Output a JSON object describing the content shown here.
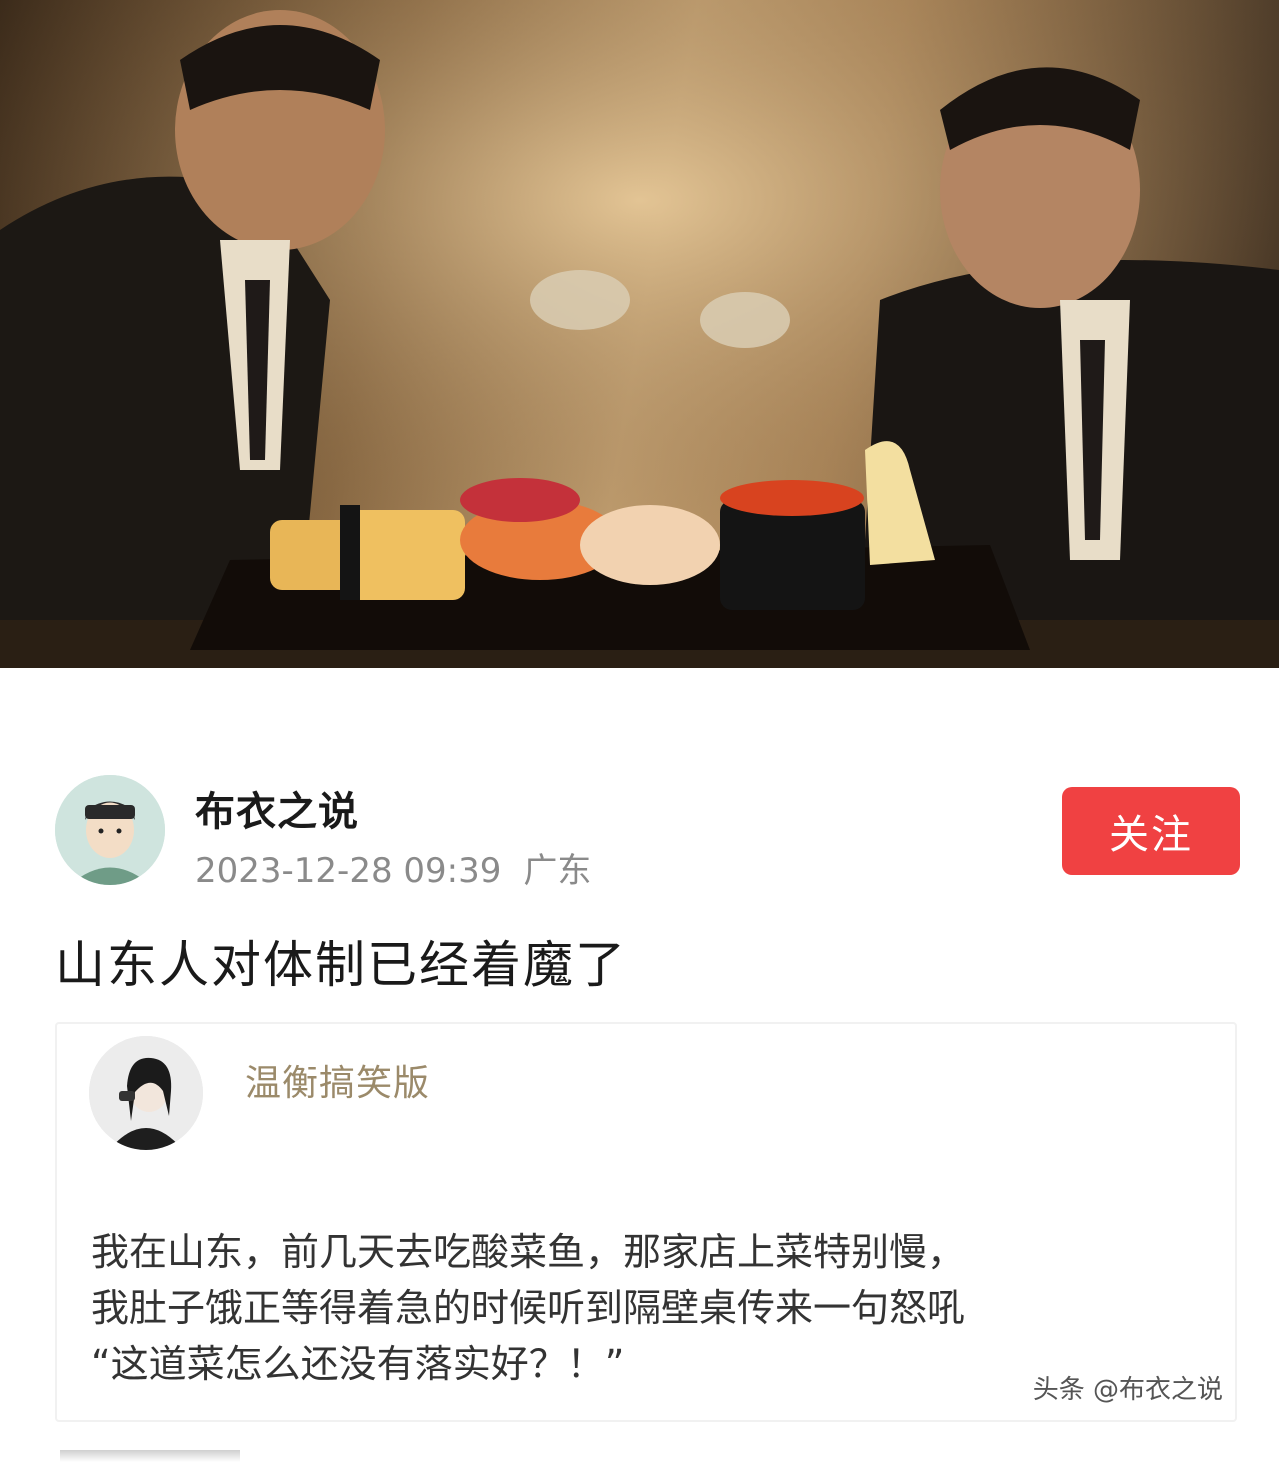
{
  "author": {
    "name": "布衣之说",
    "date": "2023-12-28 09:39",
    "location": "广东",
    "follow_label": "关注"
  },
  "post": {
    "title": "山东人对体制已经着魔了"
  },
  "quoted": {
    "name": "温衡搞笑版",
    "lines": [
      "我在山东，前几天去吃酸菜鱼，那家店上菜特别慢，",
      "我肚子饿正等得着急的时候听到隔壁桌传来一句怒吼",
      "“这道菜怎么还没有落实好？！”"
    ],
    "watermark": "头条 @布衣之说"
  },
  "colors": {
    "follow_bg": "#f04142",
    "meta_text": "#8a8a8a",
    "quoted_name": "#9b8a6a"
  }
}
